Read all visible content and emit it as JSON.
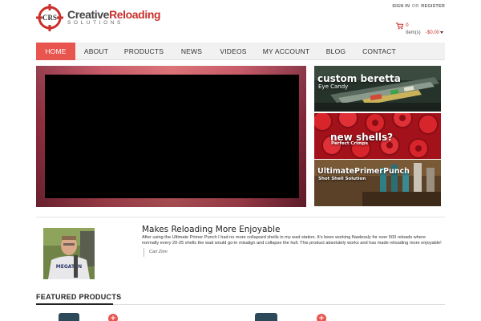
{
  "brand": {
    "logo_mark": "CRS",
    "name_part1": "Creative",
    "name_part2": "Reloading",
    "tagline": "SOLUTIONS"
  },
  "header": {
    "sign_in": "SIGN IN",
    "or": "OR",
    "register": "REGISTER"
  },
  "cart": {
    "icon": "cart-icon",
    "count": "0",
    "items_label": "Item(s)",
    "total": "-$0.00"
  },
  "nav": {
    "items": [
      {
        "label": "HOME"
      },
      {
        "label": "ABOUT"
      },
      {
        "label": "PRODUCTS"
      },
      {
        "label": "NEWS"
      },
      {
        "label": "VIDEOS"
      },
      {
        "label": "MY ACCOUNT"
      },
      {
        "label": "BLOG"
      },
      {
        "label": "CONTACT"
      }
    ]
  },
  "promos": [
    {
      "title": "custom beretta",
      "subtitle": "Eye Candy"
    },
    {
      "title": "new shells?",
      "subtitle": "Perfect Crimps"
    },
    {
      "title": "UltimatePrimerPunch",
      "subtitle": "Shot Shell Solution"
    }
  ],
  "testimonial": {
    "title": "Makes Reloading More Enjoyable",
    "body": "After using the Ultimate Primer Punch I had no more collapsed shells in my wad station. It's been working flawlessly for over 500 reloads where normally every 20-25 shells the wad would go-in misalign and collapse the hull. This product absolutely works and has made reloading more enjoyable!",
    "author": "Carl Zinn",
    "shirt_text": "MEGATEN"
  },
  "featured": {
    "title": "FEATURED PRODUCTS",
    "add_symbol": "+"
  },
  "colors": {
    "accent": "#e8554e",
    "brand_red": "#c9302c",
    "nav_bg": "#f1f1f1"
  }
}
